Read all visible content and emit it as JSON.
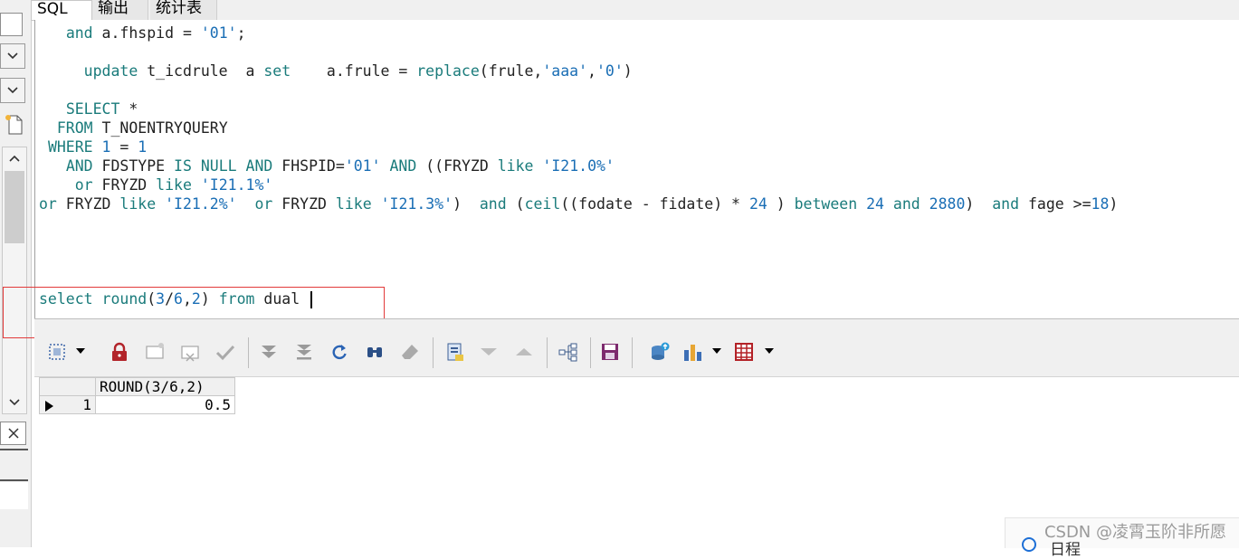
{
  "tabs": [
    {
      "label": "SQL",
      "active": true
    },
    {
      "label": "输出",
      "active": false
    },
    {
      "label": "统计表",
      "active": false
    }
  ],
  "editor": {
    "l1": {
      "indent": "   ",
      "k1": "and",
      "t1": " a.fhspid = ",
      "s1": "'01'",
      "t2": ";"
    },
    "l2": {
      "indent": "     ",
      "k1": "update",
      "t1": " t_icdrule  a ",
      "k2": "set",
      "t2": "    a.frule = ",
      "f1": "replace",
      "t3": "(frule,",
      "s1": "'aaa'",
      "t4": ",",
      "s2": "'0'",
      "t5": ")"
    },
    "l3": {
      "indent": "   ",
      "k1": "SELECT",
      "t1": " *"
    },
    "l4": {
      "indent": "  ",
      "k1": "FROM",
      "t1": " T_NOENTRYQUERY"
    },
    "l5": {
      "indent": " ",
      "k1": "WHERE",
      "t1": " ",
      "n1": "1",
      "t2": " = ",
      "n2": "1"
    },
    "l6": {
      "indent": "   ",
      "k1": "AND",
      "t1": " FDSTYPE ",
      "k2": "IS NULL",
      "t2": " ",
      "k3": "AND",
      "t3": " FHSPID=",
      "s1": "'01'",
      "t4": " ",
      "k4": "AND",
      "t5": " ((FRYZD ",
      "k5": "like",
      "t6": " ",
      "s2": "'I21.0%'"
    },
    "l7": {
      "indent": "    ",
      "k1": "or",
      "t1": " FRYZD ",
      "k2": "like",
      "t2": " ",
      "s1": "'I21.1%'"
    },
    "l8": {
      "k1": "or",
      "t1": " FRYZD ",
      "k2": "like",
      "t2": " ",
      "s1": "'I21.2%'",
      "t3": "  ",
      "k3": "or",
      "t4": " FRYZD ",
      "k4": "like",
      "t5": " ",
      "s2": "'I21.3%'",
      "t6": ")  ",
      "k5": "and",
      "t7": " (",
      "f1": "ceil",
      "t8": "((fodate - fidate) * ",
      "n1": "24",
      "t9": " ) ",
      "k6": "between",
      "t10": " ",
      "n2": "24",
      "t11": " ",
      "k7": "and",
      "t12": " ",
      "n3": "2880",
      "t13": ")  ",
      "k8": "and",
      "t14": " fage >=",
      "n4": "18",
      "t15": ")"
    },
    "l9": {
      "k1": "select",
      "t1": " ",
      "f1": "round",
      "t2": "(",
      "n1": "3",
      "t3": "/",
      "n2": "6",
      "t4": ",",
      "n3": "2",
      "t5": ") ",
      "k2": "from",
      "t6": " dual "
    }
  },
  "results": {
    "column_header": "ROUND(3/6,2)",
    "rows": [
      {
        "row_number": "1",
        "value": "0.5"
      }
    ]
  },
  "watermark": "CSDN @凌霄玉阶非所愿",
  "corner_text": "日程",
  "colors": {
    "keyword": "#1a7b7b",
    "string": "#1a6eb5",
    "highlight_border": "#e23a3a"
  },
  "icons": {
    "toolbar": [
      "grid-select-icon",
      "lock-icon",
      "new-record-icon",
      "delete-record-icon",
      "post-check-icon",
      "fetch-next-icon",
      "fetch-last-icon",
      "refresh-icon",
      "find-icon",
      "clear-icon",
      "query-by-example-icon",
      "next-record-icon",
      "previous-record-icon",
      "tree-view-icon",
      "save-icon",
      "export-icon",
      "chart-icon",
      "spreadsheet-icon"
    ]
  }
}
